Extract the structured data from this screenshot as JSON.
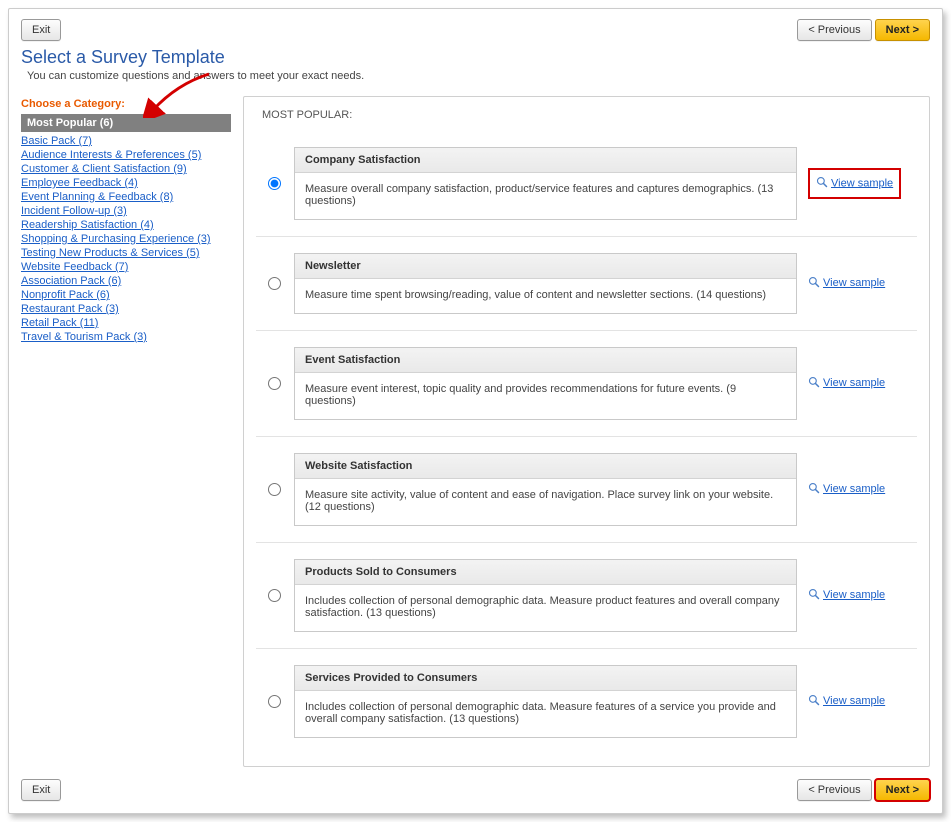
{
  "buttons": {
    "exit": "Exit",
    "prev": "< Previous",
    "next": "Next >"
  },
  "title": "Select a Survey Template",
  "subtitle": "You can customize questions and answers to meet your exact needs.",
  "choose_label": "Choose a Category:",
  "selected_category": "Most Popular (6)",
  "categories": [
    "Basic Pack (7)",
    "Audience Interests & Preferences (5)",
    "Customer & Client Satisfaction (9)",
    "Employee Feedback (4)",
    "Event Planning & Feedback (8)",
    "Incident Follow-up (3)",
    "Readership Satisfaction (4)",
    "Shopping & Purchasing Experience (3)",
    "Testing New Products & Services (5)",
    "Website Feedback (7)",
    "Association Pack (6)",
    "Nonprofit Pack (6)",
    "Restaurant Pack (3)",
    "Retail Pack (11)",
    "Travel & Tourism Pack (3)"
  ],
  "section_head": "MOST POPULAR:",
  "view_sample": "View sample",
  "templates": [
    {
      "name": "Company Satisfaction",
      "desc": "Measure overall company satisfaction, product/service features and captures demographics. (13 questions)",
      "selected": true,
      "highlight_view": true
    },
    {
      "name": "Newsletter",
      "desc": "Measure time spent browsing/reading, value of content and newsletter sections. (14 questions)",
      "selected": false,
      "highlight_view": false
    },
    {
      "name": "Event Satisfaction",
      "desc": "Measure event interest, topic quality and provides recommendations for future events. (9 questions)",
      "selected": false,
      "highlight_view": false
    },
    {
      "name": "Website Satisfaction",
      "desc": "Measure site activity, value of content and ease of navigation. Place survey link on your website. (12 questions)",
      "selected": false,
      "highlight_view": false
    },
    {
      "name": "Products Sold to Consumers",
      "desc": "Includes collection of personal demographic data. Measure product features and overall company satisfaction. (13 questions)",
      "selected": false,
      "highlight_view": false
    },
    {
      "name": "Services Provided to Consumers",
      "desc": "Includes collection of personal demographic data. Measure features of a service you provide and overall company satisfaction. (13 questions)",
      "selected": false,
      "highlight_view": false
    }
  ]
}
